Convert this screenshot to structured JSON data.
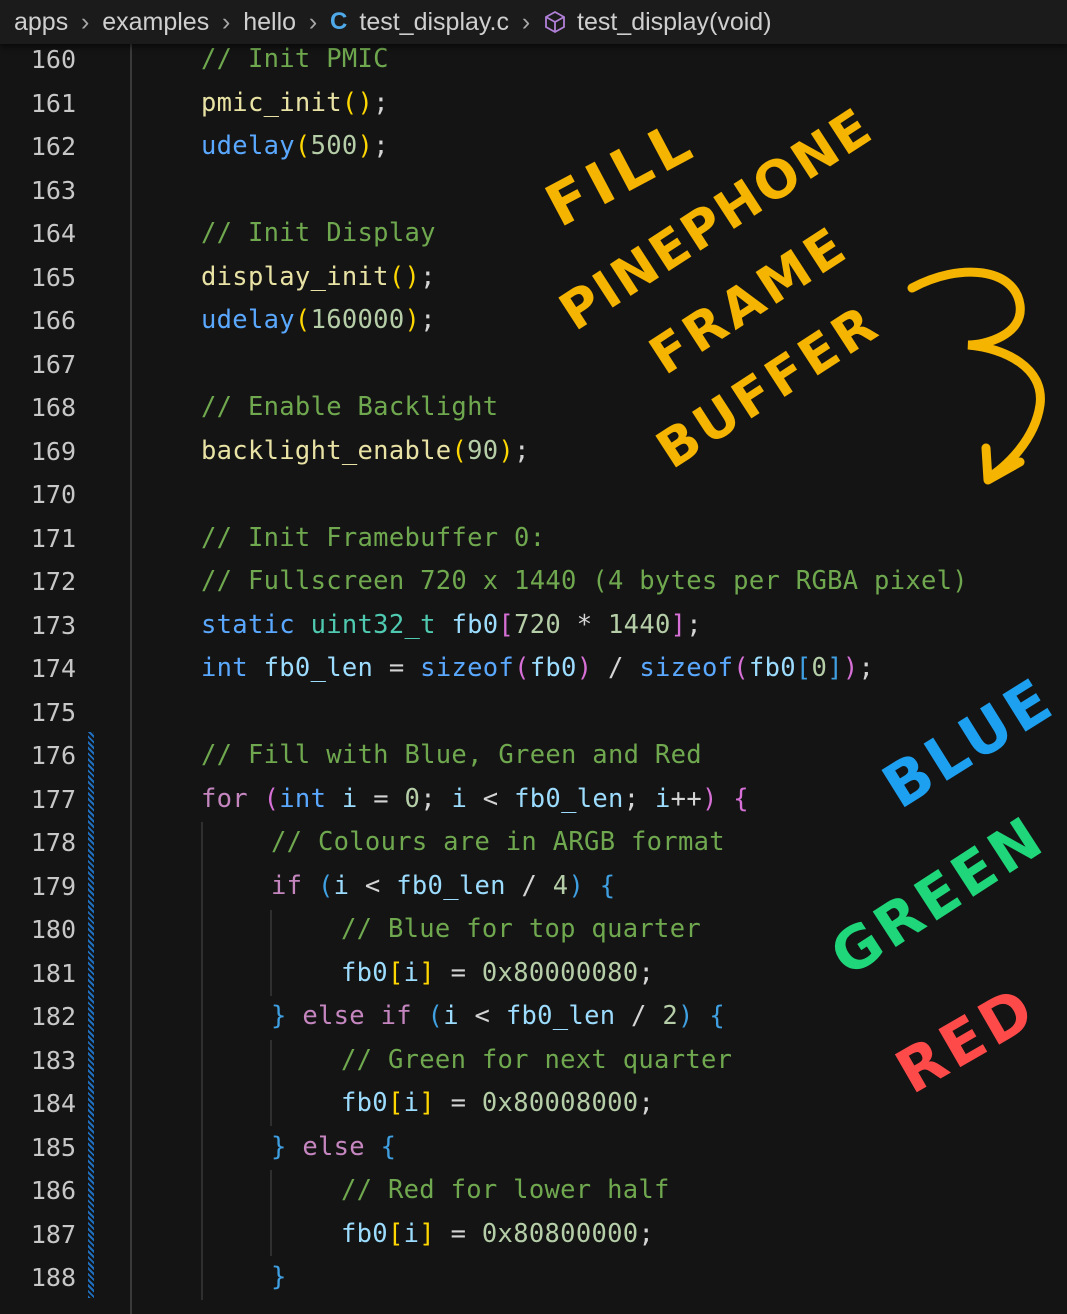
{
  "breadcrumb": {
    "items": [
      "apps",
      "examples",
      "hello"
    ],
    "file_icon": "C",
    "file": "test_display.c",
    "symbol": "test_display(void)"
  },
  "lines": [
    {
      "n": "160",
      "indent": 1,
      "tokens": [
        [
          "cm",
          "// Init PMIC"
        ]
      ]
    },
    {
      "n": "161",
      "indent": 1,
      "tokens": [
        [
          "fn",
          "pmic_init"
        ],
        [
          "pb",
          "("
        ],
        [
          "pb",
          ")"
        ],
        [
          "op",
          ";"
        ]
      ]
    },
    {
      "n": "162",
      "indent": 1,
      "tokens": [
        [
          "kw",
          "udelay"
        ],
        [
          "pb",
          "("
        ],
        [
          "nm",
          "500"
        ],
        [
          "pb",
          ")"
        ],
        [
          "op",
          ";"
        ]
      ]
    },
    {
      "n": "163",
      "indent": 0,
      "tokens": []
    },
    {
      "n": "164",
      "indent": 1,
      "tokens": [
        [
          "cm",
          "// Init Display"
        ]
      ]
    },
    {
      "n": "165",
      "indent": 1,
      "tokens": [
        [
          "fn",
          "display_init"
        ],
        [
          "pb",
          "("
        ],
        [
          "pb",
          ")"
        ],
        [
          "op",
          ";"
        ]
      ]
    },
    {
      "n": "166",
      "indent": 1,
      "tokens": [
        [
          "kw",
          "udelay"
        ],
        [
          "pb",
          "("
        ],
        [
          "nm",
          "160000"
        ],
        [
          "pb",
          ")"
        ],
        [
          "op",
          ";"
        ]
      ]
    },
    {
      "n": "167",
      "indent": 0,
      "tokens": []
    },
    {
      "n": "168",
      "indent": 1,
      "tokens": [
        [
          "cm",
          "// Enable Backlight"
        ]
      ]
    },
    {
      "n": "169",
      "indent": 1,
      "tokens": [
        [
          "fn",
          "backlight_enable"
        ],
        [
          "pb",
          "("
        ],
        [
          "nm",
          "90"
        ],
        [
          "pb",
          ")"
        ],
        [
          "op",
          ";"
        ]
      ]
    },
    {
      "n": "170",
      "indent": 0,
      "tokens": []
    },
    {
      "n": "171",
      "indent": 1,
      "tokens": [
        [
          "cm",
          "// Init Framebuffer 0:"
        ]
      ]
    },
    {
      "n": "172",
      "indent": 1,
      "tokens": [
        [
          "cm",
          "// Fullscreen 720 x 1440 (4 bytes per RGBA pixel)"
        ]
      ]
    },
    {
      "n": "173",
      "indent": 1,
      "tokens": [
        [
          "kw",
          "static"
        ],
        [
          "op",
          " "
        ],
        [
          "ty",
          "uint32_t"
        ],
        [
          "op",
          " "
        ],
        [
          "vr",
          "fb0"
        ],
        [
          "pa",
          "["
        ],
        [
          "nm",
          "720"
        ],
        [
          "op",
          " * "
        ],
        [
          "nm",
          "1440"
        ],
        [
          "pa",
          "]"
        ],
        [
          "op",
          ";"
        ]
      ]
    },
    {
      "n": "174",
      "indent": 1,
      "tokens": [
        [
          "kw",
          "int"
        ],
        [
          "op",
          " "
        ],
        [
          "vr",
          "fb0_len"
        ],
        [
          "op",
          " = "
        ],
        [
          "kw",
          "sizeof"
        ],
        [
          "pa",
          "("
        ],
        [
          "vr",
          "fb0"
        ],
        [
          "pa",
          ")"
        ],
        [
          "op",
          " / "
        ],
        [
          "kw",
          "sizeof"
        ],
        [
          "pa",
          "("
        ],
        [
          "vr",
          "fb0"
        ],
        [
          "pc",
          "["
        ],
        [
          "nm",
          "0"
        ],
        [
          "pc",
          "]"
        ],
        [
          "pa",
          ")"
        ],
        [
          "op",
          ";"
        ]
      ]
    },
    {
      "n": "175",
      "indent": 0,
      "tokens": []
    },
    {
      "n": "176",
      "indent": 1,
      "tokens": [
        [
          "cm",
          "// Fill with Blue, Green and Red"
        ]
      ]
    },
    {
      "n": "177",
      "indent": 1,
      "tokens": [
        [
          "kw2",
          "for"
        ],
        [
          "op",
          " "
        ],
        [
          "pa",
          "("
        ],
        [
          "kw",
          "int"
        ],
        [
          "op",
          " "
        ],
        [
          "vr",
          "i"
        ],
        [
          "op",
          " = "
        ],
        [
          "nm",
          "0"
        ],
        [
          "op",
          "; "
        ],
        [
          "vr",
          "i"
        ],
        [
          "op",
          " < "
        ],
        [
          "vr",
          "fb0_len"
        ],
        [
          "op",
          "; "
        ],
        [
          "vr",
          "i"
        ],
        [
          "op",
          "++"
        ],
        [
          "pa",
          ")"
        ],
        [
          "op",
          " "
        ],
        [
          "pa",
          "{"
        ]
      ]
    },
    {
      "n": "178",
      "indent": 2,
      "tokens": [
        [
          "cm",
          "// Colours are in ARGB format"
        ]
      ]
    },
    {
      "n": "179",
      "indent": 2,
      "tokens": [
        [
          "kw2",
          "if"
        ],
        [
          "op",
          " "
        ],
        [
          "pc",
          "("
        ],
        [
          "vr",
          "i"
        ],
        [
          "op",
          " < "
        ],
        [
          "vr",
          "fb0_len"
        ],
        [
          "op",
          " / "
        ],
        [
          "nm",
          "4"
        ],
        [
          "pc",
          ")"
        ],
        [
          "op",
          " "
        ],
        [
          "pc",
          "{"
        ]
      ]
    },
    {
      "n": "180",
      "indent": 3,
      "tokens": [
        [
          "cm",
          "// Blue for top quarter"
        ]
      ]
    },
    {
      "n": "181",
      "indent": 3,
      "tokens": [
        [
          "vr",
          "fb0"
        ],
        [
          "pb",
          "["
        ],
        [
          "vr",
          "i"
        ],
        [
          "pb",
          "]"
        ],
        [
          "op",
          " = "
        ],
        [
          "nm",
          "0x80000080"
        ],
        [
          "op",
          ";"
        ]
      ]
    },
    {
      "n": "182",
      "indent": 2,
      "tokens": [
        [
          "pc",
          "}"
        ],
        [
          "op",
          " "
        ],
        [
          "kw2",
          "else if"
        ],
        [
          "op",
          " "
        ],
        [
          "pc",
          "("
        ],
        [
          "vr",
          "i"
        ],
        [
          "op",
          " < "
        ],
        [
          "vr",
          "fb0_len"
        ],
        [
          "op",
          " / "
        ],
        [
          "nm",
          "2"
        ],
        [
          "pc",
          ")"
        ],
        [
          "op",
          " "
        ],
        [
          "pc",
          "{"
        ]
      ]
    },
    {
      "n": "183",
      "indent": 3,
      "tokens": [
        [
          "cm",
          "// Green for next quarter"
        ]
      ]
    },
    {
      "n": "184",
      "indent": 3,
      "tokens": [
        [
          "vr",
          "fb0"
        ],
        [
          "pb",
          "["
        ],
        [
          "vr",
          "i"
        ],
        [
          "pb",
          "]"
        ],
        [
          "op",
          " = "
        ],
        [
          "nm",
          "0x80008000"
        ],
        [
          "op",
          ";"
        ]
      ]
    },
    {
      "n": "185",
      "indent": 2,
      "tokens": [
        [
          "pc",
          "}"
        ],
        [
          "op",
          " "
        ],
        [
          "kw2",
          "else"
        ],
        [
          "op",
          " "
        ],
        [
          "pc",
          "{"
        ]
      ]
    },
    {
      "n": "186",
      "indent": 3,
      "tokens": [
        [
          "cm",
          "// Red for lower half"
        ]
      ]
    },
    {
      "n": "187",
      "indent": 3,
      "tokens": [
        [
          "vr",
          "fb0"
        ],
        [
          "pb",
          "["
        ],
        [
          "vr",
          "i"
        ],
        [
          "pb",
          "]"
        ],
        [
          "op",
          " = "
        ],
        [
          "nm",
          "0x80800000"
        ],
        [
          "op",
          ";"
        ]
      ]
    },
    {
      "n": "188",
      "indent": 2,
      "tokens": [
        [
          "pc",
          "}"
        ]
      ]
    }
  ],
  "annotations": {
    "fill": "FILL",
    "pinephone": "PINEPHONE",
    "frame": "FRAME",
    "buffer": "BUFFER",
    "blue": "BLUE",
    "green": "GREEN",
    "red": "RED",
    "yellow_color": "#f5b400",
    "blue_color": "#1ea0f0",
    "green_color": "#1fd67a",
    "red_color": "#ff4a4a"
  },
  "colors": {
    "background": "#141414",
    "comment": "#6fa84e",
    "keyword": "#5aa8ff",
    "function": "#e8e2a4",
    "number": "#b5cea8"
  }
}
